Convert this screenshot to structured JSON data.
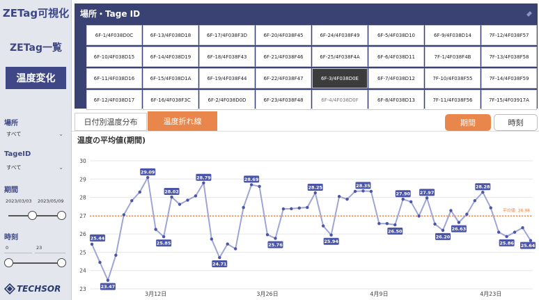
{
  "sidebar": {
    "app_title": "ZETag可視化",
    "nav_list": "ZETag一覧",
    "nav_trend": "温度変化",
    "location_label": "場所",
    "location_value": "すべて",
    "tagid_label": "TageID",
    "tagid_value": "すべて",
    "period_label": "期間",
    "period_start": "2023/03/03",
    "period_end": "2023/05/09",
    "time_label": "時刻",
    "hour_start": "0",
    "hour_end": "23",
    "logo_text": "TECHSOR"
  },
  "tag_panel": {
    "title": "場所・Tage ID",
    "tags": [
      "6F-1/4F038D0C",
      "6F-13/4F038D18",
      "6F-17/4F038F3D",
      "6F-20/4F038F45",
      "6F-24/4F038F49",
      "6F-5/4F038D10",
      "6F-9/4F038D14",
      "7F-12/4F038F57",
      "6F-10/4F038D15",
      "6F-14/4F038D19",
      "6F-18/4F038F43",
      "6F-21/4F038F46",
      "6F-25/4F038F4A",
      "6F-6/4F038D11",
      "7F-1/4F038F4B",
      "7F-13/4F038F58",
      "6F-11/4F038D16",
      "6F-15/4F038D1A",
      "6F-19/4F038F44",
      "6F-22/4F038F47",
      "6F-3/4F038D0E",
      "6F-7/4F038D12",
      "7F-10/4F038F55",
      "7F-14/4F038F59",
      "6F-12/4F038D17",
      "6F-16/4F038F3C",
      "6F-2/4F038D0D",
      "6F-23/4F038F48",
      "6F-4/4F038D0F",
      "6F-8/4F038D13",
      "7F-11/4F038F56",
      "7F-15/4F03917A"
    ],
    "selected": "6F-3/4F038D0E"
  },
  "tabs": {
    "date_dist": "日付別温度分布",
    "line": "温度折れ線",
    "period": "期間",
    "time": "時刻"
  },
  "chart_data": {
    "type": "line",
    "title": "温度の平均値(期間)",
    "xlabel": "",
    "ylabel": "",
    "ylim": [
      23,
      30
    ],
    "y_ticks": [
      23,
      24,
      25,
      26,
      27,
      28,
      29,
      30
    ],
    "x_tick_labels": [
      "3月12日",
      "3月26日",
      "4月9日",
      "4月23日"
    ],
    "x_tick_index": [
      8,
      22,
      36,
      50
    ],
    "grid": true,
    "colors": {
      "line": "#9ea5d6",
      "marker": "#4a55a8",
      "label_bg": "#4a55a8",
      "average": "#e8864b"
    },
    "average": {
      "label": "平均値: 26.98",
      "value": 26.98
    },
    "values": [
      25.44,
      24.45,
      23.47,
      24.84,
      27.05,
      27.82,
      28.29,
      29.09,
      26.25,
      25.85,
      28.02,
      27.62,
      27.85,
      28.08,
      28.79,
      25.72,
      24.71,
      25.45,
      25.19,
      27.45,
      28.69,
      28.6,
      25.96,
      25.76,
      27.37,
      27.38,
      27.42,
      27.45,
      28.25,
      26.44,
      25.94,
      28.05,
      27.9,
      28.33,
      28.35,
      28.33,
      26.57,
      26.57,
      26.5,
      27.9,
      27.76,
      26.98,
      27.97,
      26.54,
      26.2,
      27.28,
      26.63,
      27.08,
      27.82,
      28.28,
      27.43,
      26.1,
      25.86,
      26.1,
      26.34,
      25.64
    ],
    "data_labels": [
      {
        "i": 0,
        "text": "25.44"
      },
      {
        "i": 2,
        "text": "23.47"
      },
      {
        "i": 7,
        "text": "29.09"
      },
      {
        "i": 9,
        "text": "25.85"
      },
      {
        "i": 10,
        "text": "28.02"
      },
      {
        "i": 14,
        "text": "28.79"
      },
      {
        "i": 16,
        "text": "24.71"
      },
      {
        "i": 20,
        "text": "28.69"
      },
      {
        "i": 23,
        "text": "25.76"
      },
      {
        "i": 28,
        "text": "28.25"
      },
      {
        "i": 30,
        "text": "25.94"
      },
      {
        "i": 34,
        "text": "28.35"
      },
      {
        "i": 38,
        "text": "26.50"
      },
      {
        "i": 39,
        "text": "27.90"
      },
      {
        "i": 42,
        "text": "27.97"
      },
      {
        "i": 44,
        "text": "26.20"
      },
      {
        "i": 46,
        "text": "26.63"
      },
      {
        "i": 49,
        "text": "28.28"
      },
      {
        "i": 52,
        "text": "25.86"
      },
      {
        "i": 55,
        "text": "25.64"
      }
    ]
  }
}
